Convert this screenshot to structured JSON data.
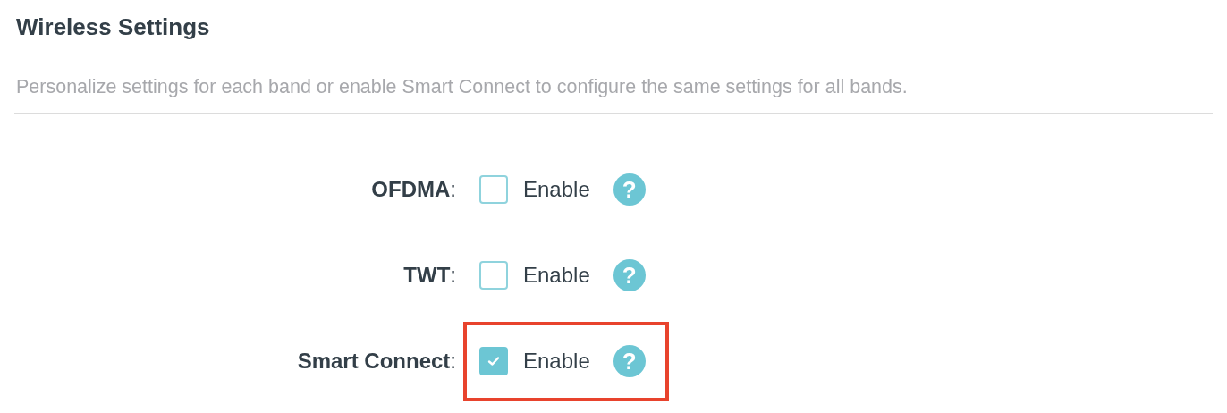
{
  "title": "Wireless Settings",
  "description": "Personalize settings for each band or enable Smart Connect to configure the same settings for all bands.",
  "settings": [
    {
      "label": "**OFDMA**:",
      "option": "Enable",
      "checked": false,
      "highlighted": false,
      "help": "?"
    },
    {
      "label": "**TWT**:",
      "option": "Enable",
      "checked": false,
      "highlighted": false,
      "help": "?"
    },
    {
      "label": "**Smart Connect**:",
      "option": "Enable",
      "checked": true,
      "highlighted": true,
      "help": "?"
    }
  ]
}
